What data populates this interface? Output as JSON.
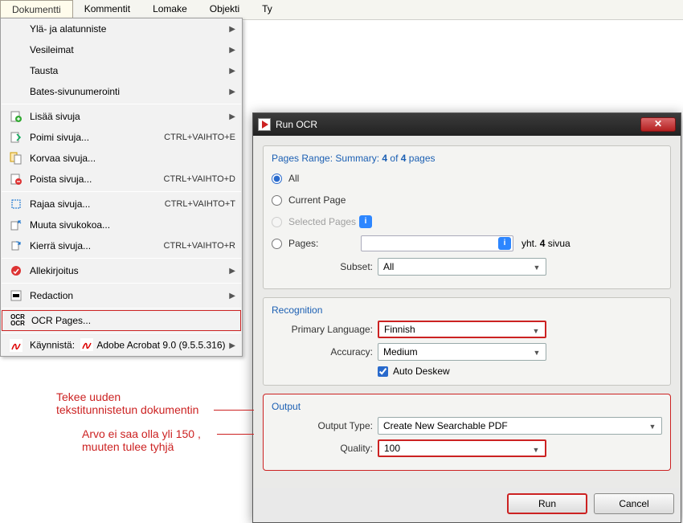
{
  "menubar": {
    "items": [
      "Dokumentti",
      "Kommentit",
      "Lomake",
      "Objekti",
      "Ty"
    ],
    "active_index": 0
  },
  "dropdown": {
    "items": [
      {
        "label": "Ylä- ja alatunniste",
        "submenu": true
      },
      {
        "label": "Vesileimat",
        "submenu": true
      },
      {
        "label": "Tausta",
        "submenu": true
      },
      {
        "label": "Bates-sivunumerointi",
        "submenu": true
      },
      {
        "sep": true
      },
      {
        "label": "Lisää sivuja",
        "submenu": true,
        "icon": "add-page"
      },
      {
        "label": "Poimi sivuja...",
        "shortcut": "CTRL+VAIHTO+E",
        "icon": "extract-page"
      },
      {
        "label": "Korvaa sivuja...",
        "icon": "replace-page"
      },
      {
        "label": "Poista sivuja...",
        "shortcut": "CTRL+VAIHTO+D",
        "icon": "delete-page"
      },
      {
        "sep": true
      },
      {
        "label": "Rajaa sivuja...",
        "shortcut": "CTRL+VAIHTO+T",
        "icon": "crop-page"
      },
      {
        "label": "Muuta sivukokoa...",
        "icon": "resize-page"
      },
      {
        "label": "Kierrä sivuja...",
        "shortcut": "CTRL+VAIHTO+R",
        "icon": "rotate-page"
      },
      {
        "sep": true
      },
      {
        "label": "Allekirjoitus",
        "submenu": true,
        "icon": "signature"
      },
      {
        "sep": true
      },
      {
        "label": "Redaction",
        "submenu": true,
        "icon": "redaction"
      },
      {
        "sep": true
      },
      {
        "label": "OCR Pages...",
        "icon": "ocr",
        "highlight": true
      },
      {
        "sep": true
      },
      {
        "label": "Käynnistä:",
        "after": "Adobe Acrobat 9.0 (9.5.5.316)",
        "submenu": true,
        "icon": "acrobat"
      }
    ]
  },
  "dialog": {
    "title": "Run OCR",
    "pages_group_title": "Pages Range: Summary: 4 of 4 pages",
    "radio_all": "All",
    "radio_current": "Current Page",
    "radio_selected": "Selected Pages",
    "radio_pages": "Pages:",
    "pages_suffix_pre": "yht. ",
    "pages_suffix_bold": "4",
    "pages_suffix_post": " sivua",
    "subset_label": "Subset:",
    "subset_value": "All",
    "recognition_title": "Recognition",
    "primary_lang_label": "Primary Language:",
    "primary_lang_value": "Finnish",
    "accuracy_label": "Accuracy:",
    "accuracy_value": "Medium",
    "auto_deskew": "Auto Deskew",
    "output_title": "Output",
    "output_type_label": "Output Type:",
    "output_type_value": "Create New Searchable PDF",
    "quality_label": "Quality:",
    "quality_value": "100",
    "run": "Run",
    "cancel": "Cancel"
  },
  "annotations": {
    "a1_line1": "Tekee uuden",
    "a1_line2": "tekstitunnistetun dokumentin",
    "a2_line1": "Arvo ei saa olla yli 150 ,",
    "a2_line2": "muuten tulee tyhjä"
  }
}
